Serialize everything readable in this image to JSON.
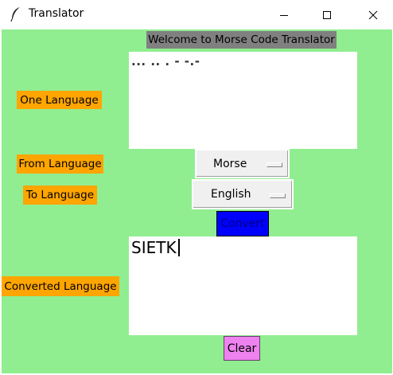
{
  "window": {
    "title": "Translator",
    "icon": "feather-icon"
  },
  "banner": "Welcome to Morse Code Translator",
  "labels": {
    "one_language": "One Language",
    "from_language": "From Language",
    "to_language": "To Language",
    "converted_language": "Converted Language"
  },
  "input": {
    "value": "... .. . - -.-"
  },
  "from_select": {
    "value": "Morse"
  },
  "to_select": {
    "value": "English"
  },
  "buttons": {
    "convert": "Convert",
    "clear": "Clear"
  },
  "output": {
    "value": "SIETK"
  },
  "colors": {
    "background": "#90ee90",
    "labels": "#ffa500",
    "banner": "#808080",
    "convert_button": "#0000ff",
    "clear_button": "#ee82ee"
  }
}
